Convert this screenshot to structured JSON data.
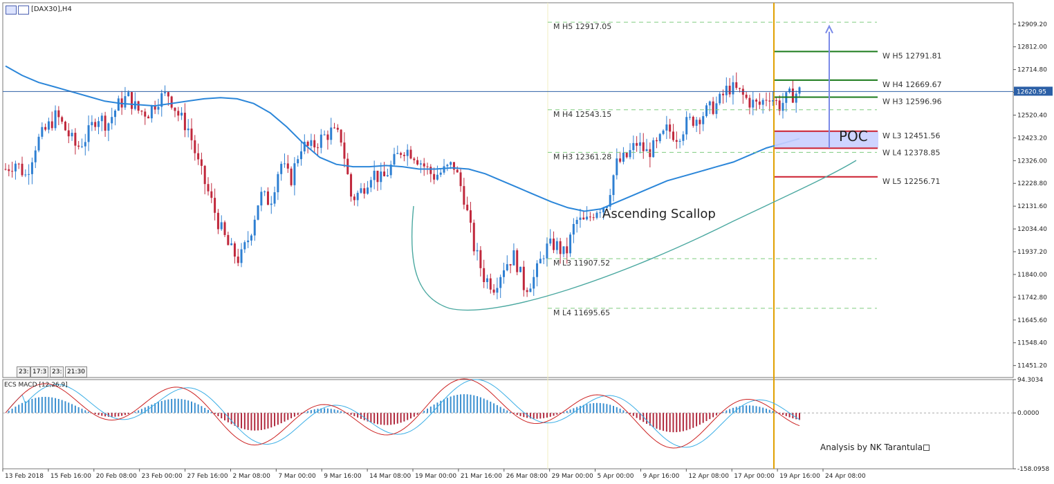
{
  "header": {
    "symbol_label": "[DAX30],H4"
  },
  "indicator": {
    "label": "ECS MACD [12,26,9]"
  },
  "annotations": {
    "pattern_label": "Ascending Scallop",
    "poc_label": "POC",
    "author_label": "Analysis by NK Tarantula"
  },
  "bottom_tabs": [
    "23:",
    "17:3",
    "23:",
    "21:30"
  ],
  "colors": {
    "bull_candle": "#2e7fd2",
    "bear_candle": "#c0283c",
    "ma_line": "#2b86d9",
    "current_price_line": "#2b5fa6",
    "period_separator": "#e0a000",
    "monthly_levels": "#7ecb7e",
    "weekly_resistance": "#1a7a1a",
    "weekly_support": "#cc1f2f",
    "poc_zone": "#c9cfff",
    "macd_main": "#cc2222",
    "macd_signal": "#3aaee6",
    "scallop_curve": "#4aa8a0"
  },
  "chart_data": {
    "type": "candlestick",
    "symbol": "[DAX30],H4",
    "price_axis": {
      "ticks": [
        "12909.20",
        "12812.00",
        "12714.80",
        "12617.60",
        "12520.40",
        "12423.20",
        "12326.00",
        "12228.80",
        "12131.60",
        "12034.40",
        "11937.20",
        "11840.00",
        "11742.80",
        "11645.60",
        "11548.40",
        "11451.20"
      ],
      "ylim": [
        11400,
        13000
      ],
      "current_price": "12620.95"
    },
    "time_axis": {
      "ticks": [
        "13 Feb 2018",
        "15 Feb 16:00",
        "20 Feb 08:00",
        "23 Feb 00:00",
        "27 Feb 16:00",
        "2 Mar 08:00",
        "7 Mar 00:00",
        "9 Mar 16:00",
        "14 Mar 08:00",
        "19 Mar 00:00",
        "21 Mar 16:00",
        "26 Mar 08:00",
        "29 Mar 00:00",
        "5 Apr 00:00",
        "9 Apr 16:00",
        "12 Apr 08:00",
        "17 Apr 00:00",
        "19 Apr 16:00",
        "24 Apr 08:00"
      ]
    },
    "close_path": [
      12290,
      12320,
      12260,
      12400,
      12460,
      12520,
      12450,
      12380,
      12430,
      12520,
      12480,
      12560,
      12600,
      12540,
      12530,
      12590,
      12610,
      12520,
      12460,
      12300,
      12180,
      12050,
      11950,
      11900,
      12010,
      12180,
      12150,
      12320,
      12240,
      12390,
      12380,
      12420,
      12450,
      12420,
      12160,
      12200,
      12280,
      12240,
      12310,
      12380,
      12360,
      12310,
      12260,
      12280,
      12310,
      12180,
      11960,
      11830,
      11790,
      11880,
      11920,
      11780,
      11830,
      11950,
      11970,
      11920,
      12070,
      12060,
      12120,
      12140,
      12310,
      12340,
      12400,
      12360,
      12390,
      12460,
      12430,
      12490,
      12510,
      12540,
      12570,
      12640,
      12620,
      12580,
      12560,
      12610,
      12560,
      12600,
      12621
    ],
    "moving_average": [
      12730,
      12690,
      12660,
      12640,
      12620,
      12600,
      12580,
      12570,
      12565,
      12560,
      12570,
      12580,
      12590,
      12595,
      12590,
      12570,
      12530,
      12470,
      12400,
      12340,
      12310,
      12300,
      12300,
      12305,
      12300,
      12290,
      12290,
      12295,
      12290,
      12270,
      12240,
      12210,
      12180,
      12150,
      12125,
      12110,
      12120,
      12150,
      12180,
      12210,
      12240,
      12260,
      12280,
      12300,
      12320,
      12350,
      12380,
      12400,
      12420
    ],
    "levels": [
      {
        "label": "M  H5 12917.05",
        "value": 12917.05,
        "group": "monthly"
      },
      {
        "label": "M  H4 12543.15",
        "value": 12543.15,
        "group": "monthly"
      },
      {
        "label": "M  H3 12361.28",
        "value": 12361.28,
        "group": "monthly"
      },
      {
        "label": "M  L3 11907.52",
        "value": 11907.52,
        "group": "monthly"
      },
      {
        "label": "M  L4 11695.65",
        "value": 11695.65,
        "group": "monthly"
      },
      {
        "label": "W  H5 12791.81",
        "value": 12791.81,
        "group": "weekly_resistance"
      },
      {
        "label": "W  H4 12669.67",
        "value": 12669.67,
        "group": "weekly_resistance"
      },
      {
        "label": "W  H3 12596.96",
        "value": 12596.96,
        "group": "weekly_resistance"
      },
      {
        "label": "W  L3 12451.56",
        "value": 12451.56,
        "group": "weekly_support"
      },
      {
        "label": "W  L4 12378.85",
        "value": 12378.85,
        "group": "weekly_support"
      },
      {
        "label": "W  L5 12256.71",
        "value": 12256.71,
        "group": "weekly_support"
      }
    ],
    "poc_zone": [
      12378.85,
      12451.56
    ],
    "target_arrow": {
      "from": 12380,
      "to": 12900
    },
    "macd": {
      "label": "ECS MACD [12,26,9]",
      "ticks": [
        "94.3034",
        "0.0000",
        "-158.0958"
      ],
      "ylim": [
        -158.0958,
        94.3034
      ]
    }
  }
}
